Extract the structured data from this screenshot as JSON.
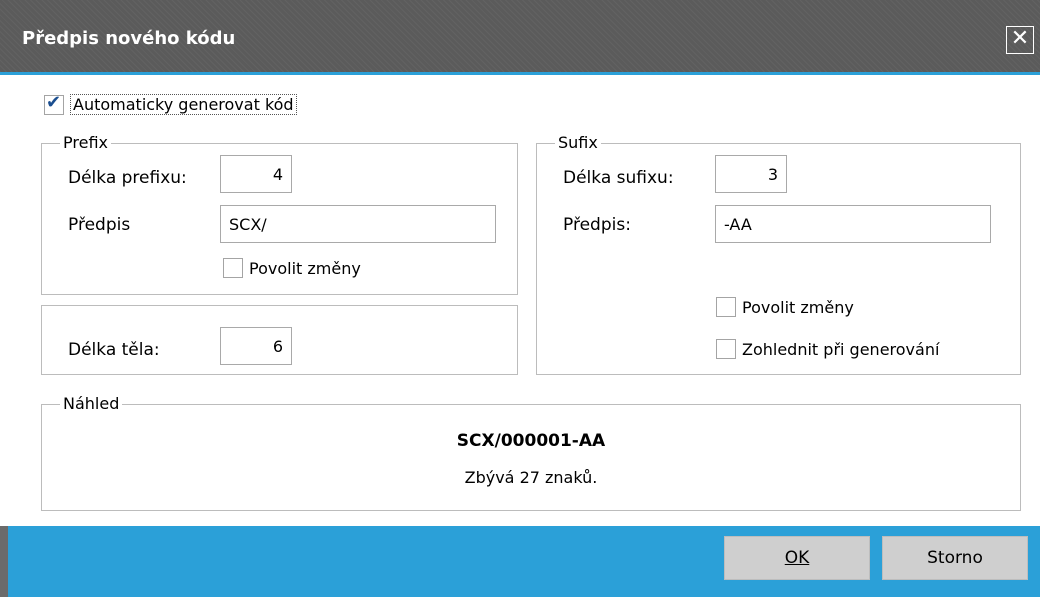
{
  "window": {
    "title": "Předpis nového kódu",
    "close_symbol": "✕"
  },
  "auto_generate": {
    "label": "Automaticky generovat kód",
    "checked": true
  },
  "prefix": {
    "legend": "Prefix",
    "length_label": "Délka prefixu:",
    "length_value": "4",
    "pattern_label": "Předpis",
    "pattern_value": "SCX/",
    "allow_changes_label": "Povolit změny",
    "allow_changes_checked": false
  },
  "body": {
    "length_label": "Délka těla:",
    "length_value": "6"
  },
  "suffix": {
    "legend": "Sufix",
    "length_label": "Délka sufixu:",
    "length_value": "3",
    "pattern_label": "Předpis:",
    "pattern_value": "-AA",
    "allow_changes_label": "Povolit změny",
    "allow_changes_checked": false,
    "consider_label": "Zohlednit při generování",
    "consider_checked": false
  },
  "preview": {
    "legend": "Náhled",
    "code": "SCX/000001-AA",
    "remaining": "Zbývá 27 znaků."
  },
  "buttons": {
    "ok_label": "OK",
    "cancel_label": "Storno"
  },
  "colors": {
    "accent": "#2ba0d8",
    "titlebar": "#5b5b5b",
    "button": "#cfcfcf"
  }
}
